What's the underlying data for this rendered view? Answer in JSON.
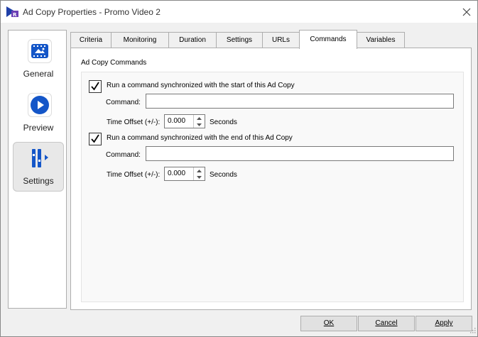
{
  "window": {
    "title": "Ad Copy Properties - Promo Video 2",
    "app_icon": "app-logo-icon",
    "close_icon": "close-icon"
  },
  "sidebar": {
    "items": [
      {
        "label": "General",
        "icon": "film-icon",
        "active": false
      },
      {
        "label": "Preview",
        "icon": "play-icon",
        "active": false
      },
      {
        "label": "Settings",
        "icon": "settings-sliders-icon",
        "active": true
      }
    ]
  },
  "tabs": [
    {
      "label": "Criteria",
      "active": false
    },
    {
      "label": "Monitoring",
      "active": false
    },
    {
      "label": "Duration",
      "active": false
    },
    {
      "label": "Settings",
      "active": false
    },
    {
      "label": "URLs",
      "active": false
    },
    {
      "label": "Commands",
      "active": true
    },
    {
      "label": "Variables",
      "active": false
    }
  ],
  "commands": {
    "section_title": "Ad Copy Commands",
    "start": {
      "checkbox_label": "Run a command synchronized with the start of this Ad Copy",
      "checked": true,
      "command_label": "Command:",
      "command_value": "",
      "offset_label": "Time Offset (+/-):",
      "offset_value": "0.000",
      "unit": "Seconds"
    },
    "end": {
      "checkbox_label": "Run a command synchronized with the end of this Ad Copy",
      "checked": true,
      "command_label": "Command:",
      "command_value": "",
      "offset_label": "Time Offset (+/-):",
      "offset_value": "0.000",
      "unit": "Seconds"
    }
  },
  "buttons": {
    "ok": "OK",
    "cancel": "Cancel",
    "apply": "Apply"
  },
  "colors": {
    "accent": "#1f5fbf",
    "icon_blue": "#1456c8"
  }
}
